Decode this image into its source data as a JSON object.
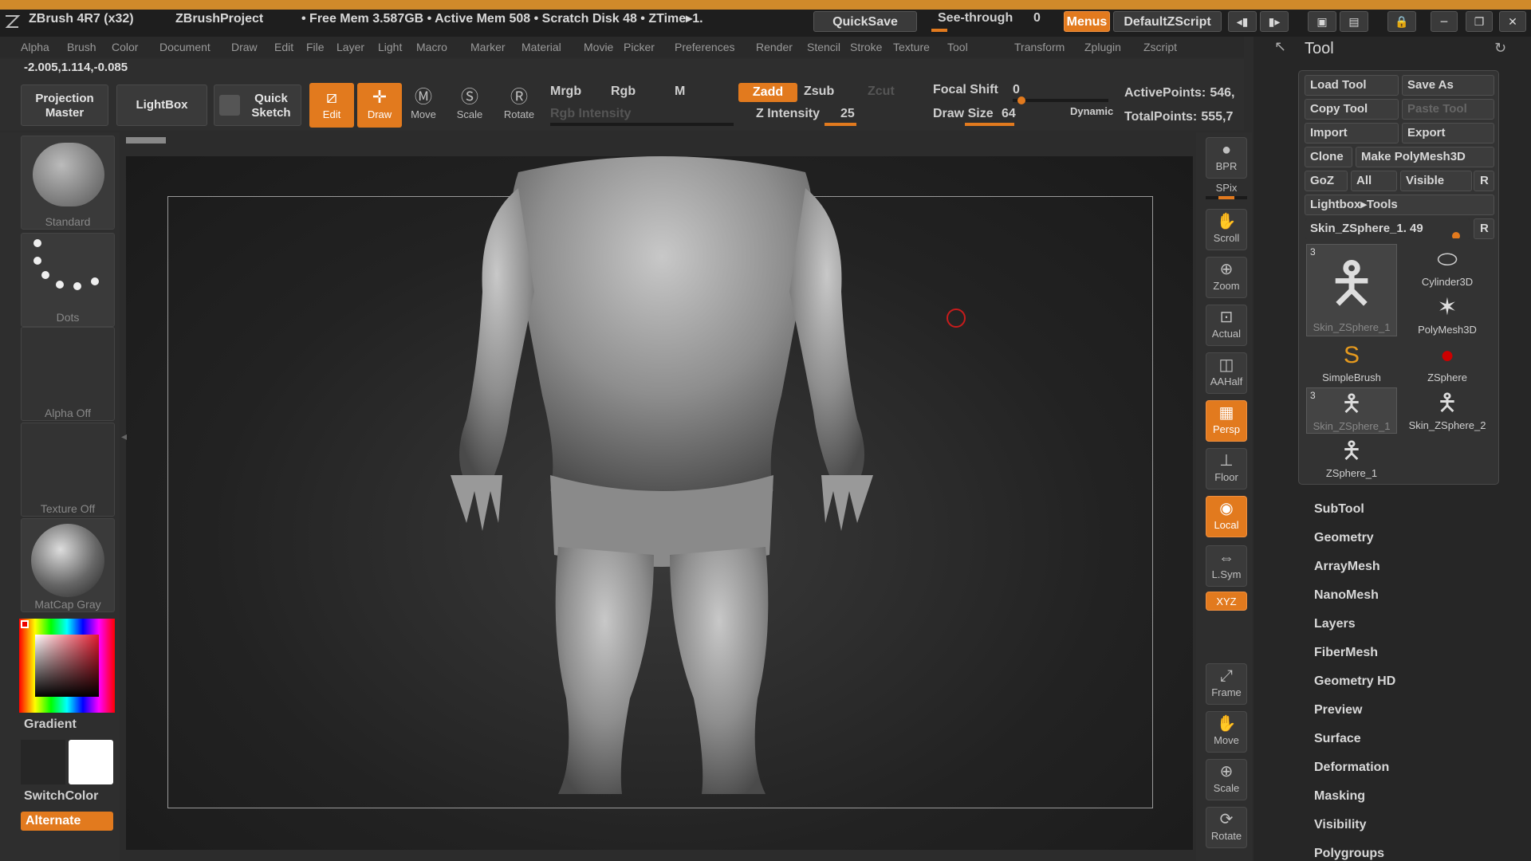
{
  "colors": {
    "accent": "#e27a1e",
    "bg": "#2c2c2c",
    "canvas": "#1e1e1e",
    "mesh": "#9d9d9d"
  },
  "titlebar": {
    "app": "ZBrush 4R7 (x32)",
    "project": "ZBrushProject",
    "status": "• Free Mem 3.587GB • Active Mem 508 • Scratch Disk 48 • ZTime▸1.",
    "quicksave": "QuickSave",
    "seethrough_label": "See-through",
    "seethrough_value": "0",
    "menus": "Menus",
    "script": "DefaultZScript"
  },
  "menubar": [
    "Alpha",
    "Brush",
    "Color",
    "Document",
    "Draw",
    "Edit",
    "File",
    "Layer",
    "Light",
    "Macro",
    "Marker",
    "Material",
    "Movie",
    "Picker",
    "Preferences",
    "Render",
    "Stencil",
    "Stroke",
    "Texture",
    "Tool",
    "Transform",
    "Zplugin",
    "Zscript"
  ],
  "toolbar": {
    "coords": "-2.005,1.114,-0.085",
    "projection_master": "Projection Master",
    "lightbox": "LightBox",
    "quick_sketch": "Quick Sketch",
    "edit": "Edit",
    "draw": "Draw",
    "move": "Move",
    "scale": "Scale",
    "rotate": "Rotate",
    "mrgb": "Mrgb",
    "rgb": "Rgb",
    "m": "M",
    "rgb_intensity": "Rgb Intensity",
    "zadd": "Zadd",
    "zsub": "Zsub",
    "zcut": "Zcut",
    "z_intensity_label": "Z Intensity",
    "z_intensity_value": "25",
    "focal_shift_label": "Focal Shift",
    "focal_shift_value": "0",
    "draw_size_label": "Draw Size",
    "draw_size_value": "64",
    "dynamic": "Dynamic",
    "active_points_label": "ActivePoints:",
    "active_points_value": "546,",
    "total_points_label": "TotalPoints:",
    "total_points_value": "555,7"
  },
  "leftshelf": {
    "brush": "Standard",
    "stroke": "Dots",
    "alpha": "Alpha Off",
    "texture": "Texture Off",
    "material": "MatCap Gray",
    "gradient": "Gradient",
    "switchcolor": "SwitchColor",
    "alternate": "Alternate"
  },
  "rightshelf": [
    "BPR",
    "SPix",
    "Scroll",
    "Zoom",
    "Actual",
    "AAHalf",
    "Persp",
    "Floor",
    "Local",
    "L.Sym",
    "XYZ",
    "Frame",
    "Move",
    "Scale",
    "Rotate"
  ],
  "rightshelf_extra": {
    "dynamic": "Dynamic"
  },
  "tool": {
    "title": "Tool",
    "load": "Load Tool",
    "save_as": "Save As",
    "copy": "Copy Tool",
    "paste": "Paste Tool",
    "import": "Import",
    "export": "Export",
    "clone": "Clone",
    "make_polymesh": "Make PolyMesh3D",
    "goz": "GoZ",
    "all": "All",
    "visible": "Visible",
    "r": "R",
    "lightbox_tools": "Lightbox▸Tools",
    "current_tool": "Skin_ZSphere_1. 49",
    "tiles": [
      {
        "name": "Skin_ZSphere_1",
        "count": "3"
      },
      {
        "name": "Cylinder3D"
      },
      {
        "name": "PolyMesh3D"
      },
      {
        "name": "SimpleBrush"
      },
      {
        "name": "ZSphere"
      },
      {
        "name": "Skin_ZSphere_1",
        "count": "3"
      },
      {
        "name": "Skin_ZSphere_2"
      },
      {
        "name": "ZSphere_1"
      }
    ],
    "subpalettes": [
      "SubTool",
      "Geometry",
      "ArrayMesh",
      "NanoMesh",
      "Layers",
      "FiberMesh",
      "Geometry HD",
      "Preview",
      "Surface",
      "Deformation",
      "Masking",
      "Visibility",
      "Polygroups"
    ]
  }
}
